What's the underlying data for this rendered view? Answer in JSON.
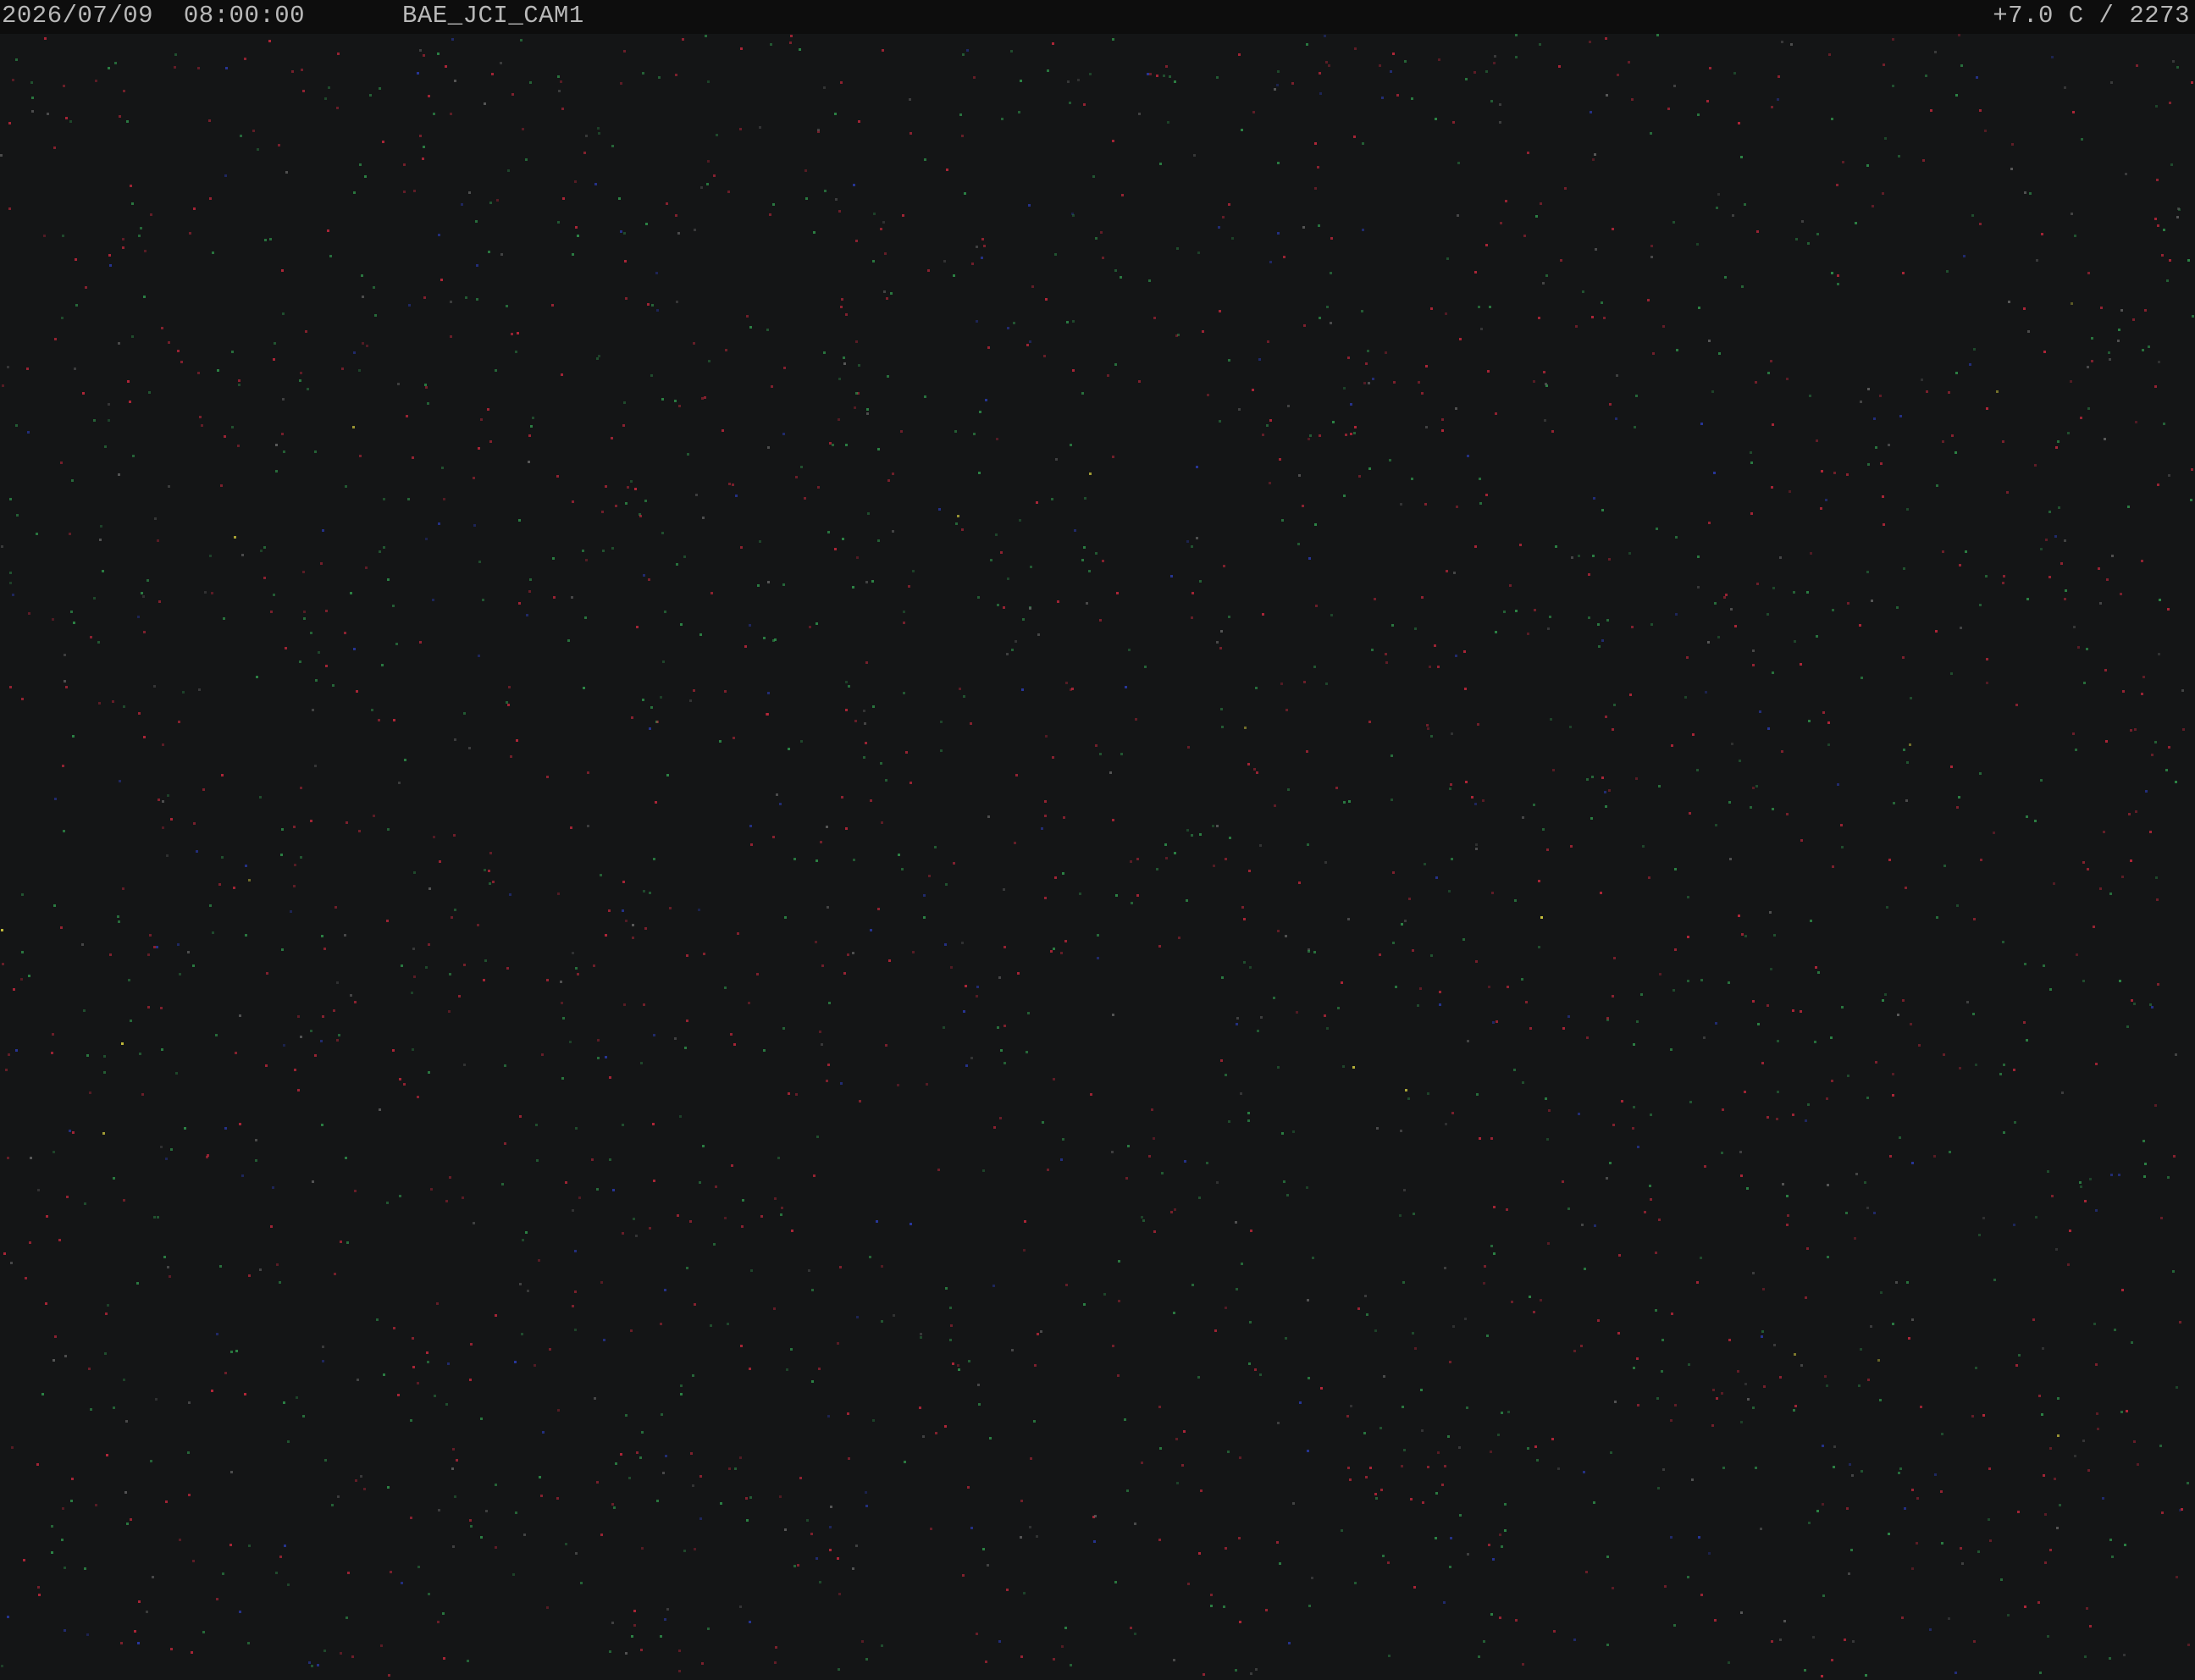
{
  "overlay": {
    "date": "2026/07/09",
    "time": "08:00:00",
    "camera_id": "BAE_JCI_CAM1",
    "temperature": "+7.0 C",
    "counter": "2273"
  },
  "colors": {
    "background": "#141516",
    "bar": "#0d0d0d",
    "text": "#b8b8b8",
    "noise": [
      "#c0283c",
      "#2f8f4a",
      "#2a3aa8",
      "#d8d040",
      "#606060"
    ]
  }
}
